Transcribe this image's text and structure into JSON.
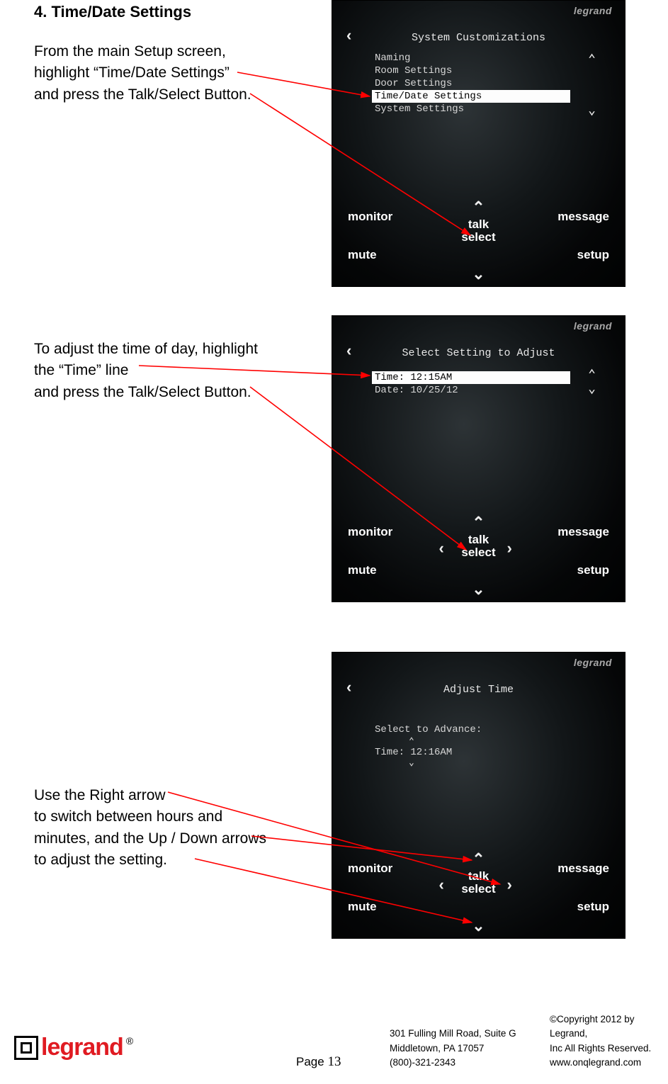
{
  "heading": "4. Time/Date Settings",
  "text_blocks": {
    "block1_l1": "From the main Setup screen,",
    "block1_l2": "highlight “Time/Date Settings”",
    "block1_l3": "and press the Talk/Select Button.",
    "block2_l1": "To adjust the time of day, highlight",
    "block2_l2": "the “Time” line",
    "block2_l3": "and press the Talk/Select Button.",
    "block3_l1": "Use the Right arrow",
    "block3_l2": "to switch between hours and",
    "block3_l3": "minutes, and the Up / Down arrows",
    "block3_l4": "to adjust the setting."
  },
  "device_brand": "legrand",
  "device1": {
    "title": "System Customizations",
    "items": [
      "Naming",
      "Room Settings",
      "Door Settings",
      "Time/Date Settings",
      "System Settings"
    ],
    "selected_index": 3
  },
  "device2": {
    "title": "Select Setting to Adjust",
    "items": [
      "Time: 12:15AM",
      "Date: 10/25/12"
    ],
    "selected_index": 0
  },
  "device3": {
    "title": "Adjust Time",
    "prompt": "Select to Advance:",
    "value": "Time: 12:16AM"
  },
  "controls": {
    "monitor": "monitor",
    "message": "message",
    "mute": "mute",
    "setup": "setup",
    "talk": "talk",
    "select": "select"
  },
  "footer": {
    "logo_text": "legrand",
    "page_label": "Page ",
    "page_number": "13",
    "address_l1": "301 Fulling Mill Road, Suite G",
    "address_l2": "Middletown, PA   17057",
    "address_l3": "(800)-321-2343",
    "copy_l1": "©Copyright 2012 by Legrand,",
    "copy_l2": "Inc All Rights Reserved.",
    "copy_l3": "www.onqlegrand.com"
  }
}
